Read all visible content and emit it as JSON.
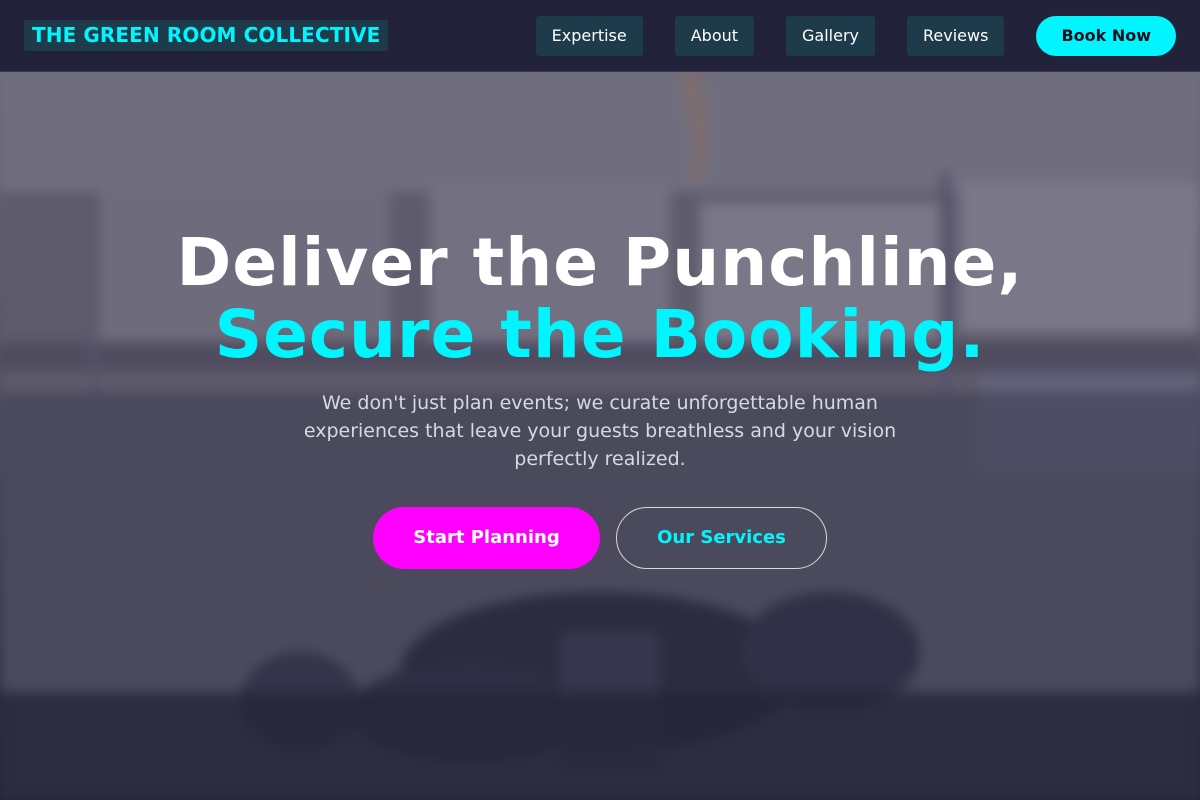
{
  "header": {
    "logo": "THE GREEN ROOM COLLECTIVE",
    "nav": [
      "Expertise",
      "About",
      "Gallery",
      "Reviews"
    ],
    "cta": "Book Now"
  },
  "hero": {
    "title_line1": "Deliver the Punchline,",
    "title_line2": "Secure the Booking.",
    "subtitle": "We don't just plan events; we curate unforgettable human experiences that leave your guests breathless and your vision perfectly realized.",
    "primary_cta": "Start Planning",
    "secondary_cta": "Our Services"
  },
  "colors": {
    "accent_cyan": "#00f5ff",
    "accent_magenta": "#ff00ff",
    "header_bg": "#22223a",
    "nav_button_bg": "#1d3b4a"
  }
}
